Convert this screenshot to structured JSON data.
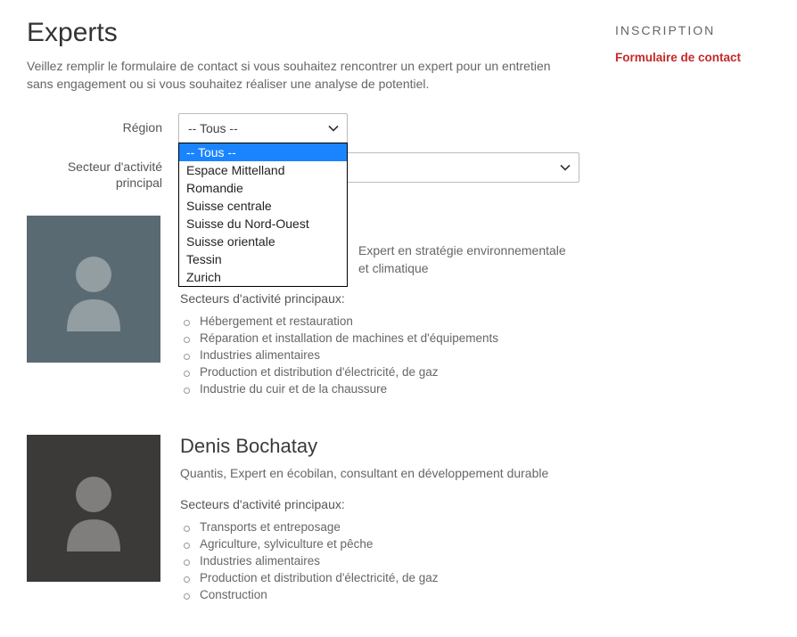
{
  "page": {
    "title": "Experts",
    "intro": "Veillez remplir le formulaire de contact si vous souhaitez rencontrer un expert pour un entretien sans engagement ou si vous souhaitez réaliser une analyse de potentiel."
  },
  "filters": {
    "region": {
      "label": "Région",
      "value": "-- Tous --",
      "options": [
        "-- Tous --",
        "Espace Mittelland",
        "Romandie",
        "Suisse centrale",
        "Suisse du Nord-Ouest",
        "Suisse orientale",
        "Tessin",
        "Zurich"
      ]
    },
    "sector": {
      "label": "Secteur d'activité principal",
      "value": ""
    }
  },
  "experts": [
    {
      "name": "",
      "role": "Expert en stratégie environnementale et climatique",
      "sectors_heading": "Secteurs d'activité principaux:",
      "sectors": [
        "Hébergement et restauration",
        "Réparation et installation de machines et d'équipements",
        "Industries alimentaires",
        "Production et distribution d'électricité, de gaz",
        "Industrie du cuir et de la chaussure"
      ],
      "avatar_bg": "#5a6a72"
    },
    {
      "name": "Denis Bochatay",
      "role": "Quantis, Expert en écobilan, consultant en développement durable",
      "sectors_heading": "Secteurs d'activité principaux:",
      "sectors": [
        "Transports et entreposage",
        "Agriculture, sylviculture et pêche",
        "Industries alimentaires",
        "Production et distribution d'électricité, de gaz",
        "Construction"
      ],
      "avatar_bg": "#3b3a38"
    }
  ],
  "sidebar": {
    "heading": "INSCRIPTION",
    "link_label": "Formulaire de contact"
  }
}
